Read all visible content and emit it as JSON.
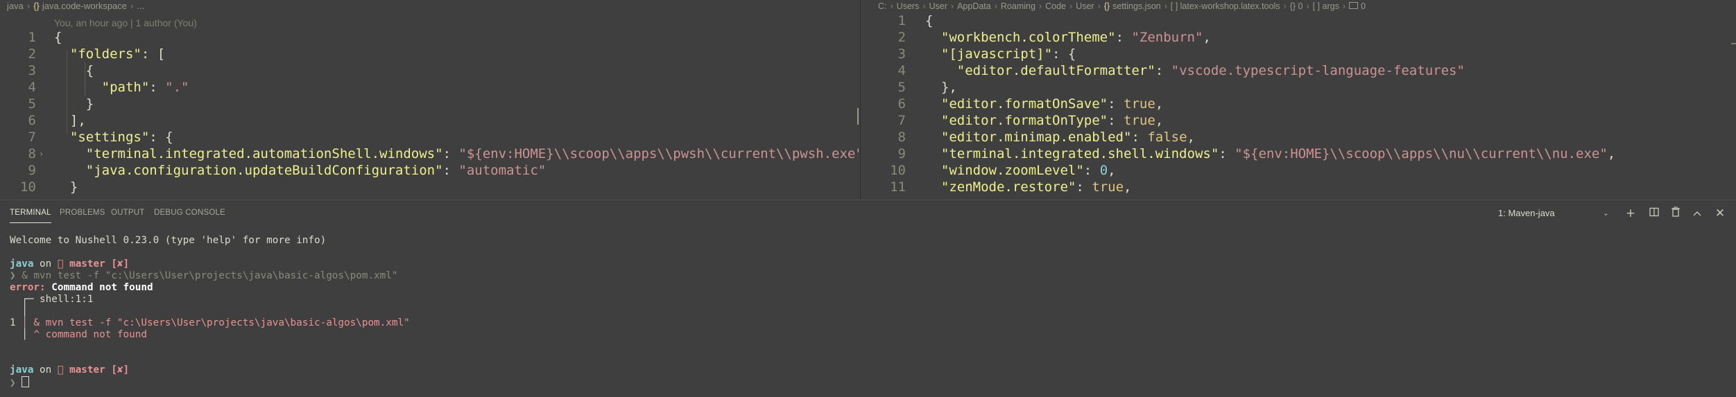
{
  "left_editor": {
    "breadcrumb": {
      "folder": "java",
      "file_icon": "{}",
      "file": "java.code-workspace",
      "more": "..."
    },
    "codelens": "You, an hour ago | 1 author (You)",
    "line_numbers": [
      "1",
      "2",
      "3",
      "4",
      "5",
      "6",
      "7",
      "8",
      "9",
      "10"
    ],
    "lines": {
      "l1": "{",
      "l2_key": "\"folders\"",
      "l2_rest": ": [",
      "l3": "  {",
      "l4_key": "\"path\"",
      "l4_colon": ": ",
      "l4_val": "\".\"",
      "l5": "  }",
      "l6": "],",
      "l7_key": "\"settings\"",
      "l7_rest": ": {",
      "l8_key": "\"terminal.integrated.automationShell.windows\"",
      "l8_colon": ": ",
      "l8_val": "\"${env:HOME}\\\\scoop\\\\apps\\\\pwsh\\\\current\\\\pwsh.exe\"",
      "l8_end": ",",
      "l9_key": "\"java.configuration.updateBuildConfiguration\"",
      "l9_colon": ": ",
      "l9_val": "\"automatic\"",
      "l10": "}"
    }
  },
  "right_editor": {
    "breadcrumb": [
      "C:",
      "Users",
      "User",
      "AppData",
      "Roaming",
      "Code",
      "User"
    ],
    "breadcrumb_file_icon": "{}",
    "breadcrumb_file": "settings.json",
    "breadcrumb_tail": "[ ] latex-workshop.latex.tools",
    "breadcrumb_obj": "{} 0",
    "breadcrumb_args": "[ ] args",
    "breadcrumb_last": "0",
    "line_numbers": [
      "1",
      "2",
      "3",
      "4",
      "5",
      "6",
      "7",
      "8",
      "9",
      "10",
      "11"
    ],
    "lines": {
      "l1": "{",
      "l2_key": "\"workbench.colorTheme\"",
      "l2_colon": ": ",
      "l2_val": "\"Zenburn\"",
      "l2_end": ",",
      "l3_key": "\"[javascript]\"",
      "l3_rest": ": {",
      "l4_key": "\"editor.defaultFormatter\"",
      "l4_colon": ": ",
      "l4_val": "\"vscode.typescript-language-features\"",
      "l5": "},",
      "l6_key": "\"editor.formatOnSave\"",
      "l6_colon": ": ",
      "l6_val": "true",
      "l6_end": ",",
      "l7_key": "\"editor.formatOnType\"",
      "l7_colon": ": ",
      "l7_val": "true",
      "l7_end": ",",
      "l8_key": "\"editor.minimap.enabled\"",
      "l8_colon": ": ",
      "l8_val": "false",
      "l8_end": ",",
      "l9_key": "\"terminal.integrated.shell.windows\"",
      "l9_colon": ": ",
      "l9_val": "\"${env:HOME}\\\\scoop\\\\apps\\\\nu\\\\current\\\\nu.exe\"",
      "l9_end": ",",
      "l10_key": "\"window.zoomLevel\"",
      "l10_colon": ": ",
      "l10_val": "0",
      "l10_end": ",",
      "l11_key": "\"zenMode.restore\"",
      "l11_colon": ": ",
      "l11_val": "true",
      "l11_end": ","
    }
  },
  "panel": {
    "tabs": [
      "TERMINAL",
      "PROBLEMS",
      "OUTPUT",
      "DEBUG CONSOLE"
    ],
    "terminal_selector": "1: Maven-java",
    "icons": [
      "add-terminal-icon",
      "split-terminal-icon",
      "trash-icon",
      "maximize-panel-icon",
      "close-panel-icon"
    ]
  },
  "terminal": {
    "welcome": "Welcome to Nushell 0.23.0 (type 'help' for more info)",
    "prompt_dir": "java",
    "prompt_on": " on ",
    "prompt_branch": " master [✘]",
    "branch_icon": "",
    "prompt_char": "❯",
    "command": " & mvn test -f \"c:\\Users\\User\\projects\\java\\basic-algos\\pom.xml\"",
    "error_label": "error:",
    "error_msg": " Command not found",
    "diag_header": "  ┌─ shell:1:1",
    "diag_pipe": "  │",
    "diag_line_no": "1",
    "diag_code": " │ & mvn test -f \"c:\\Users\\User\\projects\\java\\basic-algos\\pom.xml\"",
    "diag_marker_prefix": "  │ ",
    "diag_marker": "^ command not found"
  },
  "colors": {
    "background": "#3f3f3f",
    "json_key": "#efef8f",
    "json_string": "#cc9393",
    "json_keyword": "#dfc47d",
    "json_number": "#8cd0d3",
    "terminal_cyan": "#8cd0d3",
    "terminal_red": "#e89393"
  }
}
